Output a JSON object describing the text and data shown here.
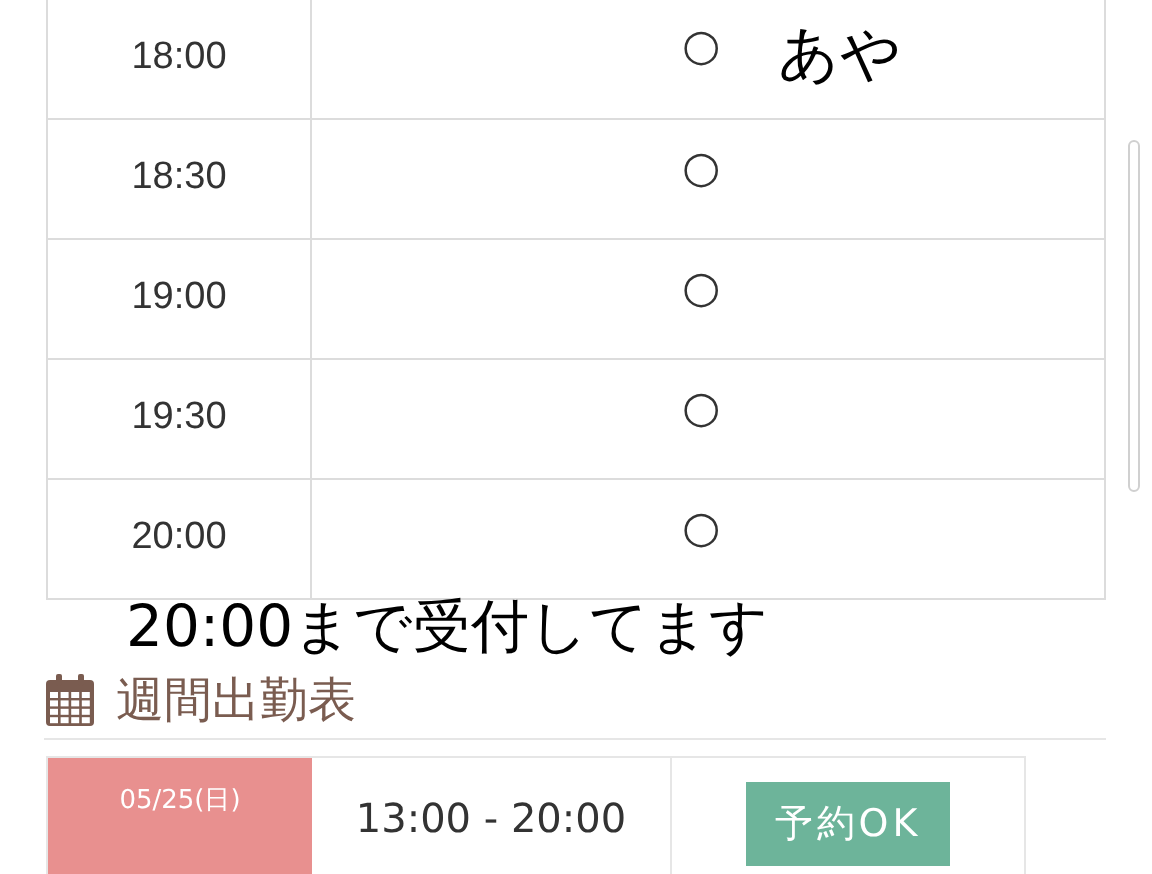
{
  "slots": [
    {
      "time": "18:00",
      "mark": "○",
      "name": "あや"
    },
    {
      "time": "18:30",
      "mark": "○"
    },
    {
      "time": "19:00",
      "mark": "○"
    },
    {
      "time": "19:30",
      "mark": "○"
    },
    {
      "time": "20:00",
      "mark": "○"
    }
  ],
  "notice": "20:00まで受付してます",
  "weekly": {
    "title": "週間出勤表",
    "rows": [
      {
        "date": "05/25(日)",
        "hours": "13:00 - 20:00",
        "status": "予約OK"
      }
    ]
  }
}
